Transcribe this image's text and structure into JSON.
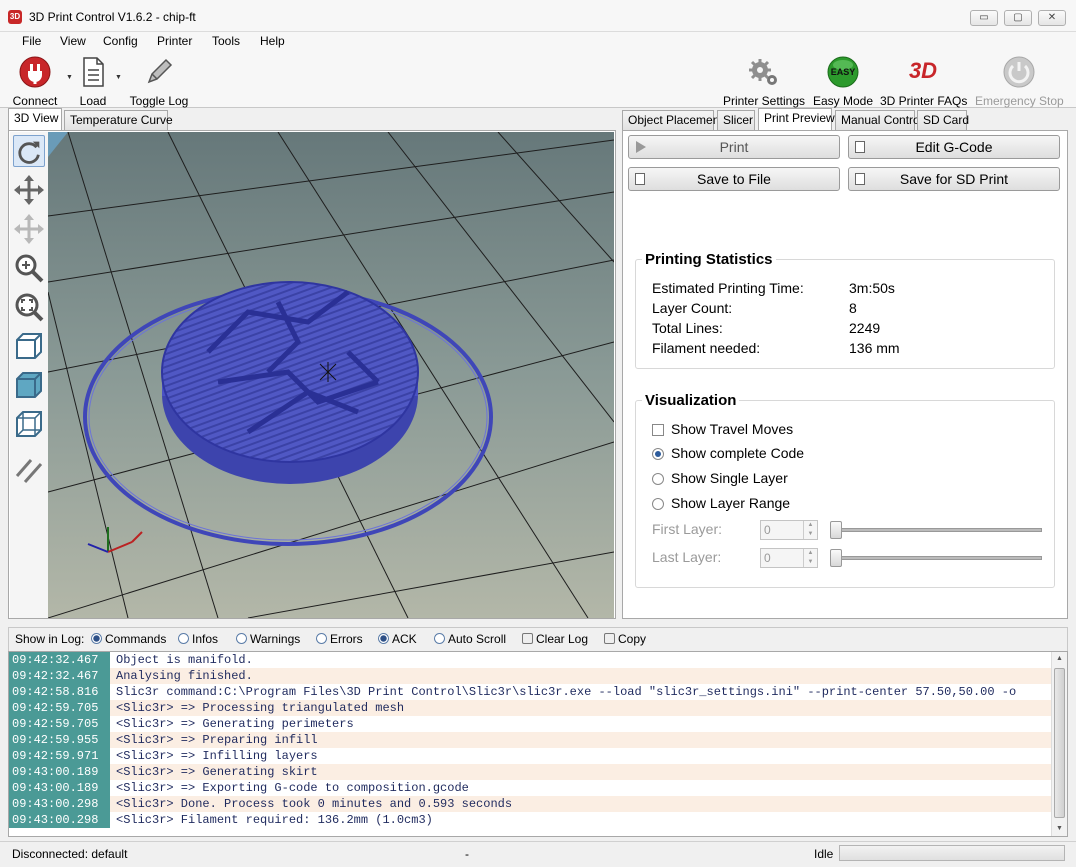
{
  "window": {
    "title": "3D Print Control V1.6.2 - chip-ft",
    "app_icon_text": "3D",
    "minimize": "▭",
    "maximize": "▢",
    "close": "✕"
  },
  "menu": [
    "File",
    "View",
    "Config",
    "Printer",
    "Tools",
    "Help"
  ],
  "toolbar": {
    "connect": "Connect",
    "load": "Load",
    "toggle_log": "Toggle Log",
    "printer_settings": "Printer Settings",
    "easy_mode": "Easy Mode",
    "easy_badge": "EASY",
    "faqs": "3D Printer FAQs",
    "faqs_logo": "3D",
    "emergency_stop": "Emergency Stop"
  },
  "left_tabs": [
    "3D View",
    "Temperature Curve"
  ],
  "right_tabs": [
    "Object Placement",
    "Slicer",
    "Print Preview",
    "Manual Control",
    "SD Card"
  ],
  "active_right_tab": "Print Preview",
  "preview": {
    "print_button": "Print",
    "edit_gcode_button": "Edit G-Code",
    "save_file_button": "Save to File",
    "save_sd_button": "Save for SD Print"
  },
  "statistics": {
    "title": "Printing Statistics",
    "rows": [
      {
        "label": "Estimated Printing Time:",
        "value": "3m:50s"
      },
      {
        "label": "Layer Count:",
        "value": "8"
      },
      {
        "label": "Total Lines:",
        "value": "2249"
      },
      {
        "label": "Filament needed:",
        "value": "136 mm"
      }
    ]
  },
  "visualization": {
    "title": "Visualization",
    "show_travel": "Show Travel Moves",
    "show_complete": "Show complete Code",
    "show_single": "Show Single Layer",
    "show_range": "Show Layer Range",
    "first_layer_label": "First Layer:",
    "first_layer_value": "0",
    "last_layer_label": "Last Layer:",
    "last_layer_value": "0",
    "selected_option": "Show complete Code"
  },
  "log_options": {
    "label": "Show in Log:",
    "commands": "Commands",
    "infos": "Infos",
    "warnings": "Warnings",
    "errors": "Errors",
    "ack": "ACK",
    "auto_scroll": "Auto Scroll",
    "clear_log": "Clear Log",
    "copy": "Copy"
  },
  "log": [
    {
      "time": "09:42:32.467",
      "msg": "Object is manifold."
    },
    {
      "time": "09:42:32.467",
      "msg": "Analysing finished."
    },
    {
      "time": "09:42:58.816",
      "msg": "Slic3r command:C:\\Program Files\\3D Print Control\\Slic3r\\slic3r.exe --load \"slic3r_settings.ini\" --print-center 57.50,50.00 -o"
    },
    {
      "time": "09:42:59.705",
      "msg": "<Slic3r> => Processing triangulated mesh"
    },
    {
      "time": "09:42:59.705",
      "msg": "<Slic3r> => Generating perimeters"
    },
    {
      "time": "09:42:59.955",
      "msg": "<Slic3r> => Preparing infill"
    },
    {
      "time": "09:42:59.971",
      "msg": "<Slic3r> => Infilling layers"
    },
    {
      "time": "09:43:00.189",
      "msg": "<Slic3r> => Generating skirt"
    },
    {
      "time": "09:43:00.189",
      "msg": "<Slic3r> => Exporting G-code to composition.gcode"
    },
    {
      "time": "09:43:00.298",
      "msg": "<Slic3r> Done. Process took 0 minutes and 0.593 seconds"
    },
    {
      "time": "09:43:00.298",
      "msg": "<Slic3r> Filament required: 136.2mm (1.0cm3)"
    }
  ],
  "status": {
    "connection": "Disconnected: default",
    "middle": "-",
    "state": "Idle"
  },
  "colors": {
    "model": "#4a52c4",
    "timestamp_bg": "#4b9a96",
    "viewport_bg": "#7f9192"
  }
}
